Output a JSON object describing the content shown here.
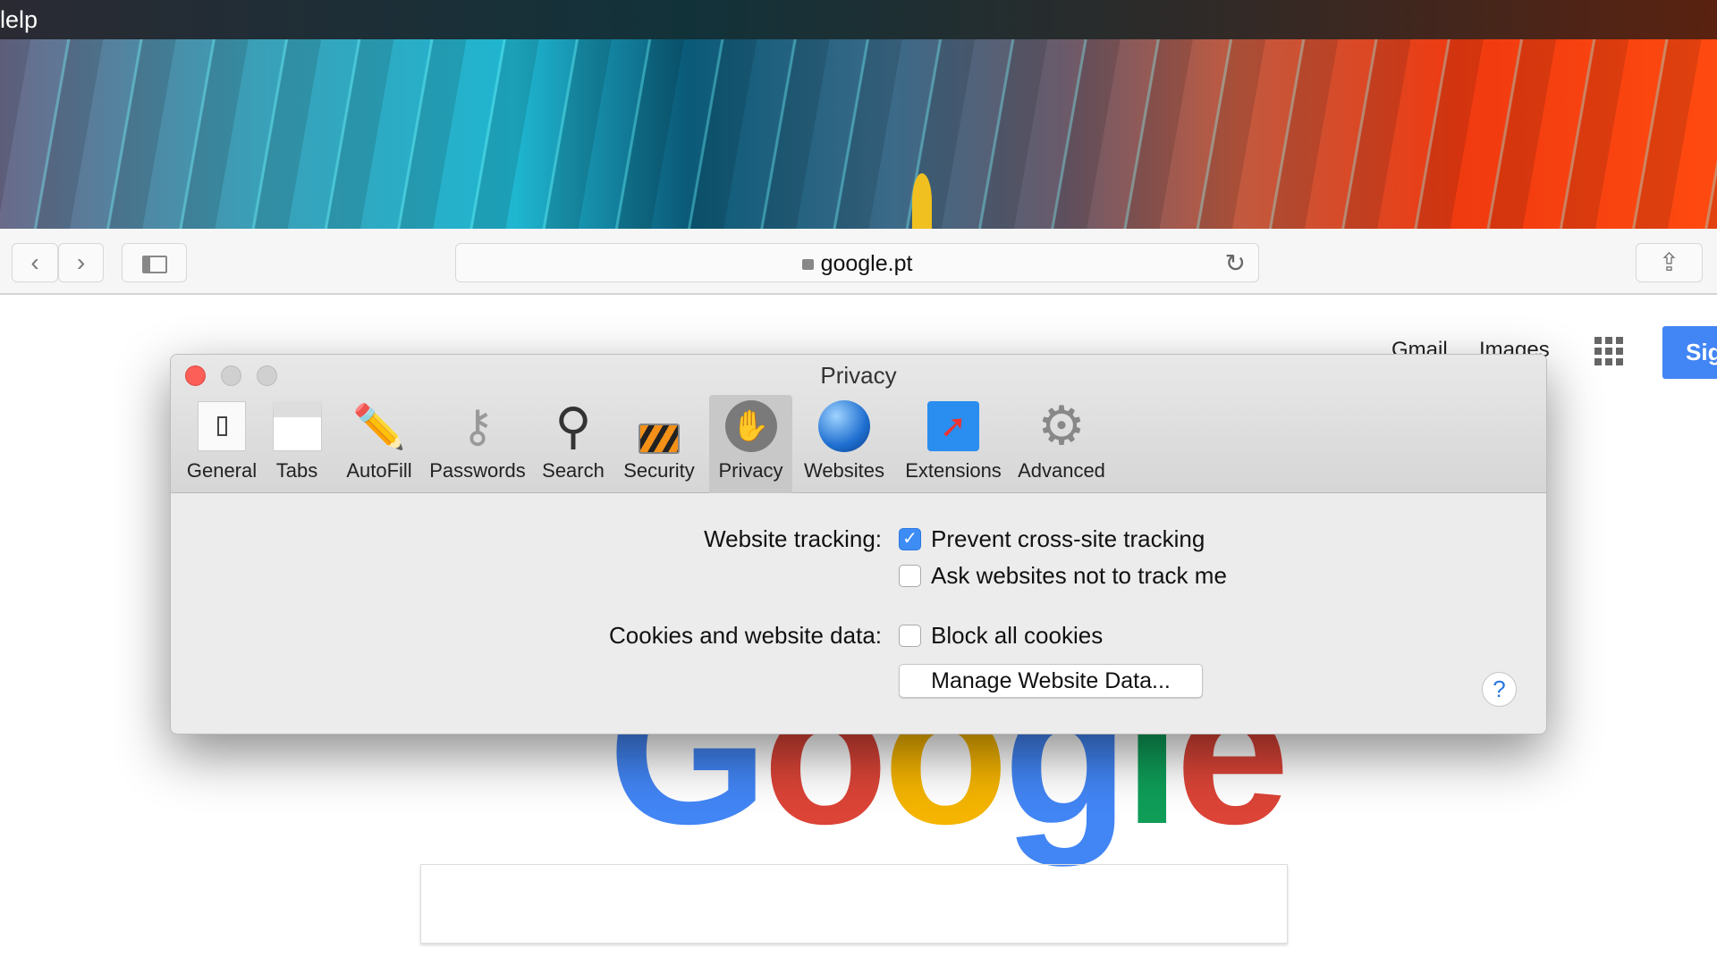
{
  "menubar": {
    "item": "Help",
    "visible_text": "lelp"
  },
  "browser": {
    "url": "google.pt",
    "icons": {
      "back": "chevron-left-icon",
      "forward": "chevron-right-icon",
      "sidebar": "sidebar-icon",
      "lock": "lock-icon",
      "reload": "reload-icon",
      "share": "share-icon"
    }
  },
  "page": {
    "links": [
      "Gmail",
      "Images"
    ],
    "signin_label": "Sig",
    "logo": "Google"
  },
  "dialog": {
    "title": "Privacy",
    "tabs": [
      {
        "label": "General",
        "icon": "switch-icon"
      },
      {
        "label": "Tabs",
        "icon": "tabs-icon"
      },
      {
        "label": "AutoFill",
        "icon": "pencil-icon"
      },
      {
        "label": "Passwords",
        "icon": "key-icon"
      },
      {
        "label": "Search",
        "icon": "magnifier-icon"
      },
      {
        "label": "Security",
        "icon": "padlock-icon"
      },
      {
        "label": "Privacy",
        "icon": "hand-icon",
        "selected": true
      },
      {
        "label": "Websites",
        "icon": "globe-icon"
      },
      {
        "label": "Extensions",
        "icon": "puzzle-compass-icon"
      },
      {
        "label": "Advanced",
        "icon": "gear-icon"
      }
    ],
    "website_tracking_label": "Website tracking:",
    "prevent_tracking": {
      "label": "Prevent cross-site tracking",
      "checked": true
    },
    "ask_not_track": {
      "label": "Ask websites not to track me",
      "checked": false
    },
    "cookies_label": "Cookies and website data:",
    "block_cookies": {
      "label": "Block all cookies",
      "checked": false
    },
    "manage_button": "Manage Website Data...",
    "help": "?"
  },
  "colors": {
    "accent": "#3d8df5",
    "close": "#fc5f57",
    "signin": "#4285f4"
  }
}
